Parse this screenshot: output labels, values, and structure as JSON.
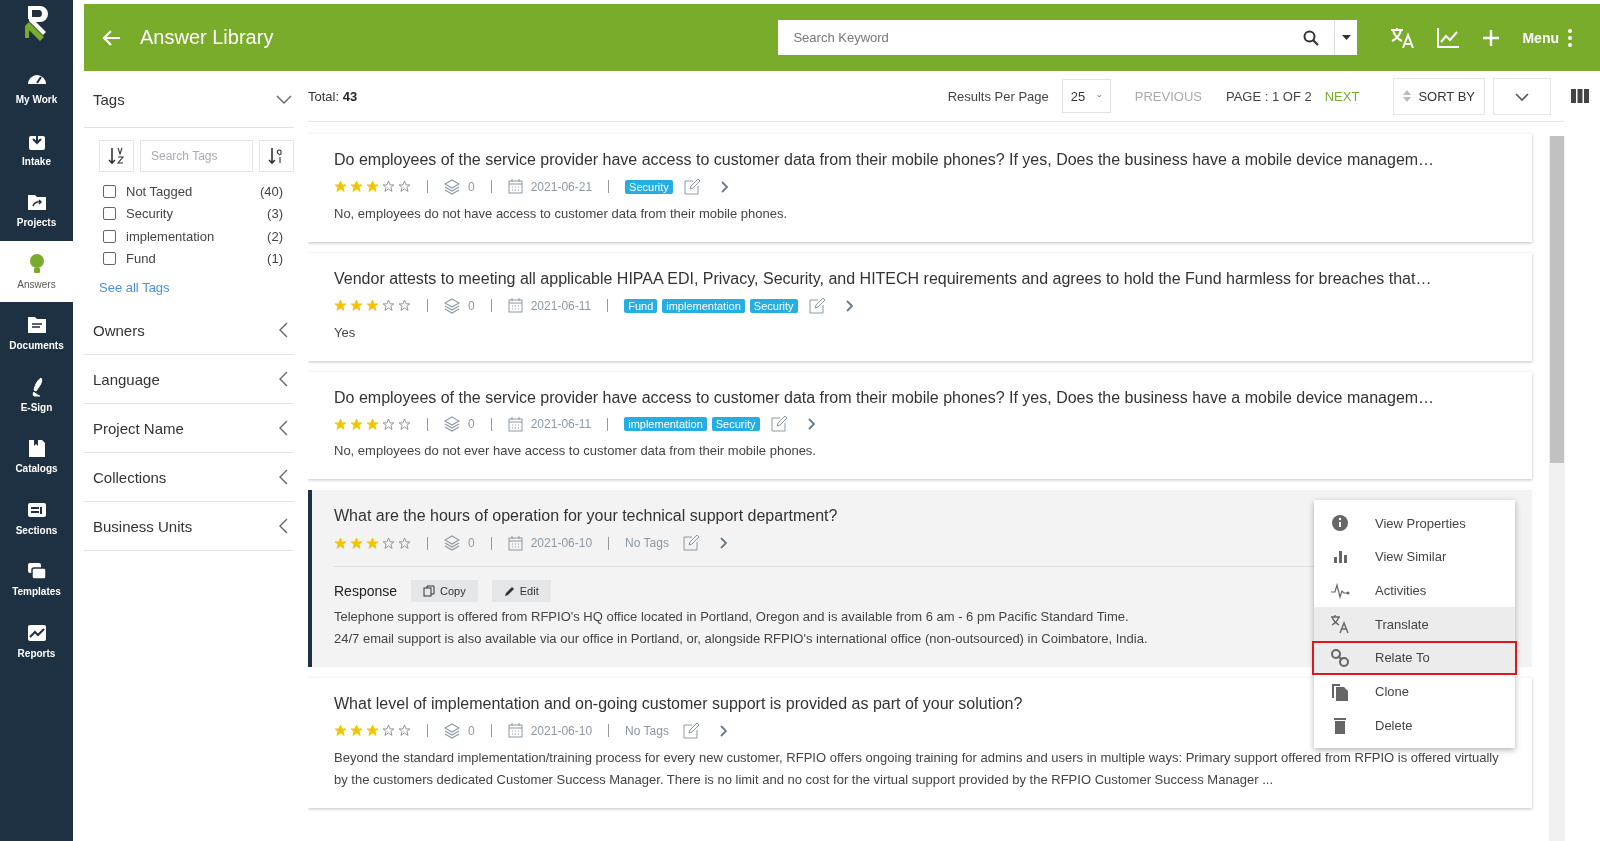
{
  "nav": {
    "items": [
      {
        "label": "My Work",
        "selected": false
      },
      {
        "label": "Intake",
        "selected": false
      },
      {
        "label": "Projects",
        "selected": false
      },
      {
        "label": "Answers",
        "selected": true
      },
      {
        "label": "Documents",
        "selected": false
      },
      {
        "label": "E-Sign",
        "selected": false
      },
      {
        "label": "Catalogs",
        "selected": false
      },
      {
        "label": "Sections",
        "selected": false
      },
      {
        "label": "Templates",
        "selected": false
      },
      {
        "label": "Reports",
        "selected": false
      }
    ]
  },
  "header": {
    "title": "Answer Library",
    "search": {
      "placeholder": "Search Keyword"
    },
    "menu_label": "Menu"
  },
  "filters": {
    "tags": {
      "title": "Tags",
      "expanded": true,
      "search": {
        "placeholder": "Search Tags"
      },
      "items": [
        {
          "label": "Not Tagged",
          "count": "(40)",
          "checked": false
        },
        {
          "label": "Security",
          "count": "(3)",
          "checked": false
        },
        {
          "label": "implementation",
          "count": "(2)",
          "checked": false
        },
        {
          "label": "Fund",
          "count": "(1)",
          "checked": false
        }
      ],
      "see_all": "See all Tags"
    },
    "sections": [
      {
        "title": "Owners",
        "expanded": false
      },
      {
        "title": "Language",
        "expanded": false
      },
      {
        "title": "Project Name",
        "expanded": false
      },
      {
        "title": "Collections",
        "expanded": false
      },
      {
        "title": "Business Units",
        "expanded": false
      }
    ]
  },
  "toolbar": {
    "total_label": "Total:",
    "total": "43",
    "per_page_label": "Results Per Page",
    "per_page": "25",
    "previous": {
      "label": "PREVIOUS",
      "disabled": true
    },
    "page": "PAGE : 1 OF 2",
    "next": {
      "label": "NEXT",
      "disabled": false
    },
    "sort": "SORT BY"
  },
  "cards": [
    {
      "question": "Do employees of the service provider have access to customer data from their mobile phones? If yes, Does the business have a mobile device managem…",
      "stars": 3,
      "count": "0",
      "date": "2021-06-21",
      "tags": [
        {
          "label": "Security"
        }
      ],
      "answer": "No, employees do not have access to customer data from their mobile phones.",
      "expanded": false
    },
    {
      "question": "Vendor attests to meeting all applicable HIPAA EDI, Privacy, Security, and HITECH requirements and agrees to hold the Fund harmless for breaches that…",
      "stars": 3,
      "count": "0",
      "date": "2021-06-11",
      "tags": [
        {
          "label": "Fund"
        },
        {
          "label": "implementation"
        },
        {
          "label": "Security"
        }
      ],
      "answer": "Yes",
      "expanded": false
    },
    {
      "question": "Do employees of the service provider have access to customer data from their mobile phones? If yes, Does the business have a mobile device managem…",
      "stars": 3,
      "count": "0",
      "date": "2021-06-11",
      "tags": [
        {
          "label": "implementation"
        },
        {
          "label": "Security"
        }
      ],
      "answer": "No, employees do not ever have access to customer data from their mobile phones.",
      "expanded": false
    },
    {
      "question": "What are the hours of operation for your technical support department?",
      "stars": 3,
      "count": "0",
      "date": "2021-06-10",
      "no_tags": "No Tags",
      "expanded": true,
      "response": {
        "label": "Response",
        "copy": "Copy",
        "edit": "Edit",
        "lines": [
          "Telephone support is offered from RFPIO's HQ office located in Portland, Oregon and is available from 6 am - 6 pm Pacific Standard Time.",
          "24/7 email support is also available via our office in Portland, or, alongside RFPIO's international office (non-outsourced) in Coimbatore, India."
        ]
      }
    },
    {
      "question": "What level of implementation and on-going customer support is provided as part of your solution?",
      "stars": 3,
      "count": "0",
      "date": "2021-06-10",
      "no_tags": "No Tags",
      "answer": "Beyond the standard implementation/training process for every new customer, RFPIO offers ongoing training for admins and users in multiple ways: Primary support offered from RFPIO is offered virtually by the customers dedicated Customer Success Manager. There is no limit and no cost for the virtual support provided by the RFPIO Customer Success Manager ...",
      "expanded": false
    }
  ],
  "context_menu": {
    "items": [
      {
        "label": "View Properties",
        "hovered": false,
        "outlined": false
      },
      {
        "label": "View Similar",
        "hovered": false,
        "outlined": false
      },
      {
        "label": "Activities",
        "hovered": false,
        "outlined": false
      },
      {
        "label": "Translate",
        "hovered": true,
        "outlined": false
      },
      {
        "label": "Relate To",
        "hovered": true,
        "outlined": true
      },
      {
        "label": "Clone",
        "hovered": false,
        "outlined": false
      },
      {
        "label": "Delete",
        "hovered": false,
        "outlined": false
      }
    ]
  }
}
